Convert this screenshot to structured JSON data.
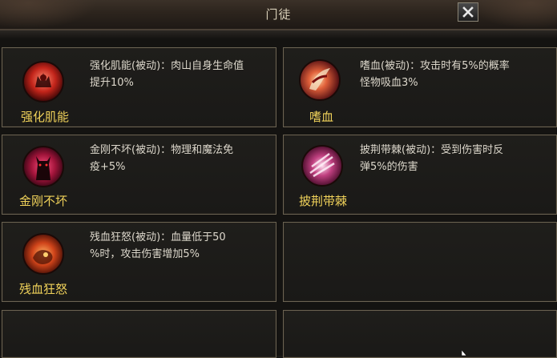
{
  "window": {
    "title": "门徒",
    "close_label": "X"
  },
  "skills": [
    {
      "name": "强化肌能",
      "desc_line1": "强化肌能(被动)：肉山自身生命值",
      "desc_line2": "提升10%",
      "icon": "muscle-skill-icon"
    },
    {
      "name": "嗜血",
      "desc_line1": "嗜血(被动)：攻击时有5%的概率",
      "desc_line2": "怪物吸血3%",
      "icon": "bloodthirst-skill-icon"
    },
    {
      "name": "金刚不坏",
      "desc_line1": "金刚不坏(被动)：物理和魔法免",
      "desc_line2": "疫+5%",
      "icon": "invulnerable-skill-icon"
    },
    {
      "name": "披荆带棘",
      "desc_line1": "披荆带棘(被动)：受到伤害时反",
      "desc_line2": "弹5%的伤害",
      "icon": "thorns-skill-icon"
    },
    {
      "name": "残血狂怒",
      "desc_line1": "残血狂怒(被动)：血量低于50",
      "desc_line2": "%时，攻击伤害增加5%",
      "icon": "rage-skill-icon"
    }
  ],
  "colors": {
    "skill_name": "#f0d25a",
    "description": "#ddd8cc",
    "card_border": "#6b6352",
    "background": "#141311"
  }
}
